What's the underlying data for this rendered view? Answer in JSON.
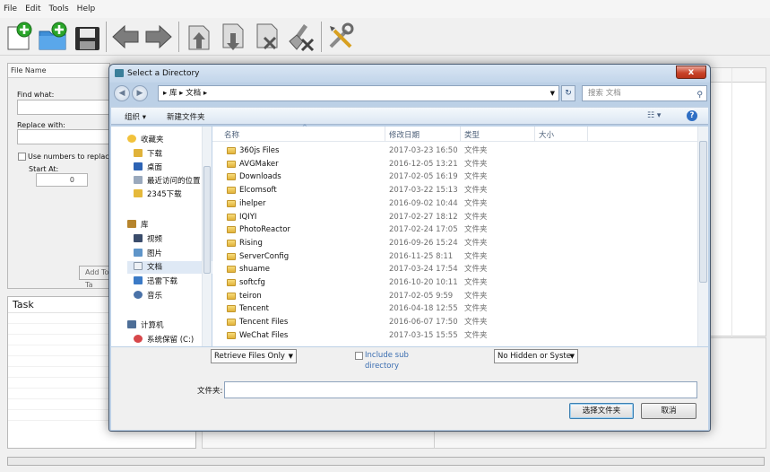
{
  "app": {
    "menu": [
      "File",
      "Edit",
      "Tools",
      "Help"
    ],
    "toolbar_icons": [
      "new-file-icon",
      "open-folder-icon",
      "save-icon",
      "back-arrow-icon",
      "forward-arrow-icon",
      "move-up-icon",
      "move-down-icon",
      "delete-icon",
      "clear-icon",
      "settings-tools-icon"
    ],
    "left_pane": {
      "column_header": "File Name",
      "find_label": "Find what:",
      "replace_label": "Replace with:",
      "use_numbers_label": "Use numbers to replace  #'s",
      "start_at_label": "Start At:",
      "start_at_value": "0",
      "add_button": "Add To Ta"
    },
    "task_pane": {
      "header": "Task"
    }
  },
  "dialog": {
    "title": "Select a Directory",
    "close_label": "x",
    "address": "▸ 库 ▸ 文档 ▸",
    "search_placeholder": "搜索 文档",
    "organize_label": "组织 ▾",
    "new_folder_label": "新建文件夹",
    "tree": {
      "favorites": "收藏夹",
      "downloads": "下载",
      "desktop": "桌面",
      "recent": "最近访问的位置",
      "downloads_2345": "2345下载",
      "library": "库",
      "videos": "视频",
      "pictures": "图片",
      "documents": "文档",
      "thunder": "迅雷下载",
      "music": "音乐",
      "computer": "计算机",
      "system_drive": "系统保留 (C:)"
    },
    "columns": {
      "name": "名称",
      "date": "修改日期",
      "type": "类型",
      "size": "大小"
    },
    "files": [
      {
        "name": "360js Files",
        "date": "2017-03-23 16:50",
        "type": "文件夹"
      },
      {
        "name": "AVGMaker",
        "date": "2016-12-05 13:21",
        "type": "文件夹"
      },
      {
        "name": "Downloads",
        "date": "2017-02-05 16:19",
        "type": "文件夹"
      },
      {
        "name": "Elcomsoft",
        "date": "2017-03-22 15:13",
        "type": "文件夹"
      },
      {
        "name": "ihelper",
        "date": "2016-09-02 10:44",
        "type": "文件夹"
      },
      {
        "name": "IQIYI",
        "date": "2017-02-27 18:12",
        "type": "文件夹"
      },
      {
        "name": "PhotoReactor",
        "date": "2017-02-24 17:05",
        "type": "文件夹"
      },
      {
        "name": "Rising",
        "date": "2016-09-26 15:24",
        "type": "文件夹"
      },
      {
        "name": "ServerConfig",
        "date": "2016-11-25 8:11",
        "type": "文件夹"
      },
      {
        "name": "shuame",
        "date": "2017-03-24 17:54",
        "type": "文件夹"
      },
      {
        "name": "softcfg",
        "date": "2016-10-20 10:11",
        "type": "文件夹"
      },
      {
        "name": "teiron",
        "date": "2017-02-05 9:59",
        "type": "文件夹"
      },
      {
        "name": "Tencent",
        "date": "2016-04-18 12:55",
        "type": "文件夹"
      },
      {
        "name": "Tencent Files",
        "date": "2016-06-07 17:50",
        "type": "文件夹"
      },
      {
        "name": "WeChat Files",
        "date": "2017-03-15 15:55",
        "type": "文件夹"
      }
    ],
    "retrieve_select": "Retrieve Files Only",
    "include_sub_label": "Include sub directory",
    "hidden_select": "No Hidden or Syste",
    "folder_label": "文件夹:",
    "folder_value": "",
    "select_button": "选择文件夹",
    "cancel_button": "取消"
  }
}
